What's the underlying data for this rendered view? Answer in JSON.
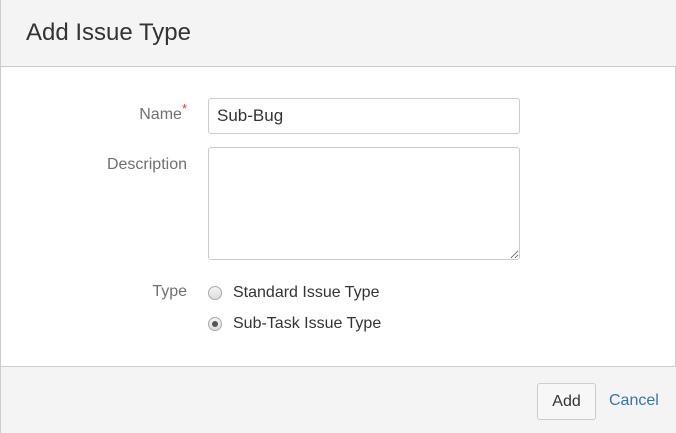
{
  "dialog": {
    "title": "Add Issue Type"
  },
  "form": {
    "name_label": "Name",
    "required_marker": "*",
    "name_value": "Sub-Bug",
    "description_label": "Description",
    "description_value": "",
    "type_label": "Type",
    "type_options": [
      {
        "label": "Standard Issue Type",
        "selected": false
      },
      {
        "label": "Sub-Task Issue Type",
        "selected": true
      }
    ]
  },
  "footer": {
    "add_label": "Add",
    "cancel_label": "Cancel"
  }
}
